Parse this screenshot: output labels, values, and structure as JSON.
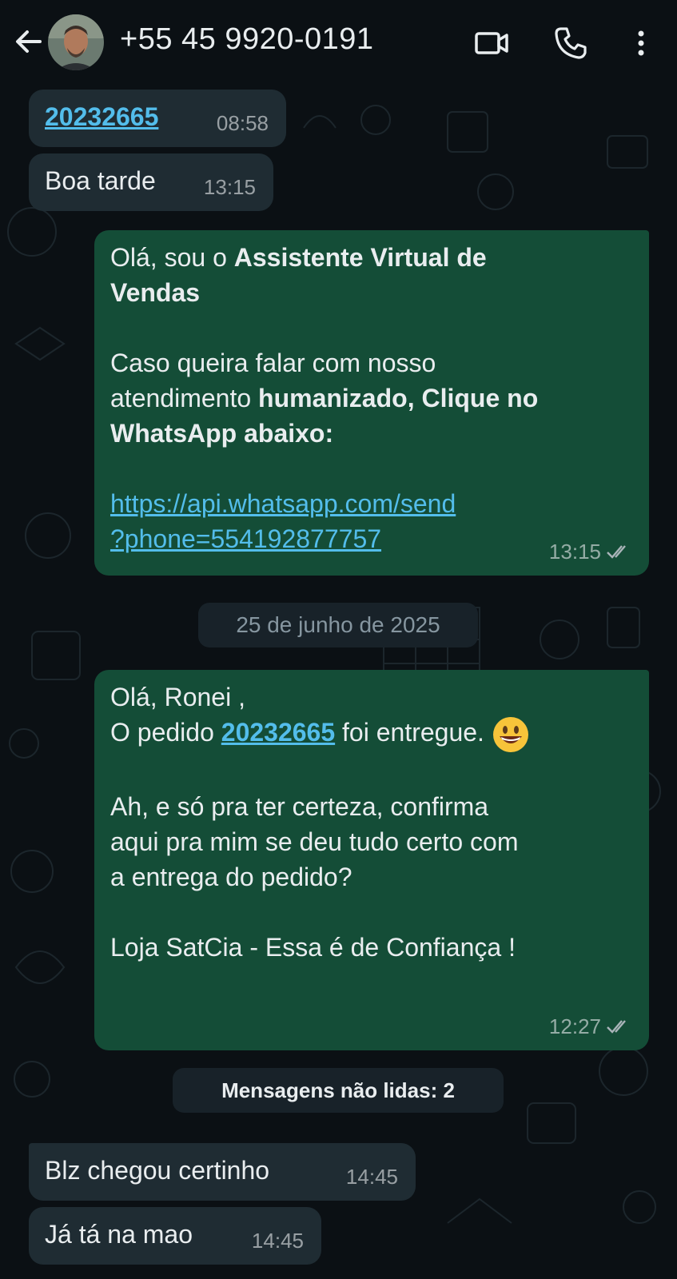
{
  "header": {
    "contact_name": "+55 45 9920-0191",
    "icons": [
      "arrow-back-icon",
      "avatar",
      "video-call-icon",
      "phone-icon",
      "more-vert-icon"
    ]
  },
  "messages": [
    {
      "id": "m1",
      "direction": "incoming",
      "link_text": "20232665",
      "time": "08:58"
    },
    {
      "id": "m2",
      "direction": "incoming",
      "text": "Boa tarde",
      "time": "13:15"
    },
    {
      "id": "m3",
      "direction": "outgoing",
      "line1_plain": "Olá, sou o ",
      "line1_bold": "Assistente Virtual de",
      "line2_bold": "Vendas",
      "line3": "Caso queira falar com nosso",
      "line4_plain": "atendimento ",
      "line4_bold": "humanizado, Clique no",
      "line5_bold": "WhatsApp abaixo:",
      "link_line1": "https://api.whatsapp.com/send",
      "link_line2": "?phone=554192877757",
      "time": "13:15",
      "status": "read"
    },
    {
      "id": "m4",
      "direction": "outgoing",
      "line1": "Olá, Ronei ,",
      "line2_before": "O pedido ",
      "line2_link": "20232665",
      "line2_after": " foi entregue.",
      "line2_emoji": "grinning-face-emoji",
      "line3": "Ah, e só pra ter certeza, confirma",
      "line4": "aqui pra mim se deu tudo certo com",
      "line5": "a entrega do pedido?",
      "line6": "Loja SatCia - Essa é de Confiança !",
      "time": "12:27",
      "status": "read"
    },
    {
      "id": "m5",
      "direction": "incoming",
      "text": "Blz chegou certinho",
      "time": "14:45"
    },
    {
      "id": "m6",
      "direction": "incoming",
      "text": "Já tá na mao",
      "time": "14:45"
    }
  ],
  "date_separator": "25 de junho de 2025",
  "unread_banner": "Mensagens não lidas: 2",
  "colors": {
    "background": "#0b1014",
    "incoming_bubble": "#1f2c33",
    "outgoing_bubble": "#144d37",
    "link": "#53bdeb",
    "text": "#e9edef",
    "meta": "#8696a0"
  }
}
